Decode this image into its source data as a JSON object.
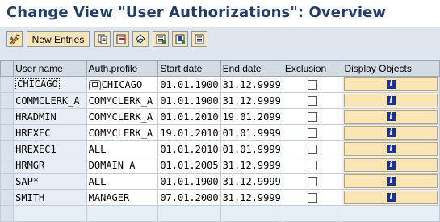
{
  "title": "Change View \"User Authorizations\": Overview",
  "toolbar": {
    "new_entries_label": "New Entries",
    "icons": [
      "edit-display-toggle-icon",
      "copy-icon",
      "delete-icon",
      "undo-icon",
      "select-all-icon",
      "select-block-icon",
      "deselect-all-icon"
    ]
  },
  "table": {
    "columns": [
      "User name",
      "Auth.profile",
      "Start date",
      "End date",
      "Exclusion",
      "Display Objects"
    ],
    "rows": [
      {
        "user": "CHICAGO",
        "profile": "CHICAGO",
        "start": "01.01.1900",
        "end": "31.12.9999",
        "exclusion": false
      },
      {
        "user": "COMMCLERK_A",
        "profile": "COMMCLERK_A",
        "start": "01.01.1900",
        "end": "31.12.9999",
        "exclusion": false
      },
      {
        "user": "HRADMIN",
        "profile": "COMMCLERK_A",
        "start": "01.01.2010",
        "end": "19.01.2099",
        "exclusion": false
      },
      {
        "user": "HREXEC",
        "profile": "COMMCLERK_A",
        "start": "19.01.2010",
        "end": "01.01.9999",
        "exclusion": false
      },
      {
        "user": "HREXEC1",
        "profile": "ALL",
        "start": "01.01.2010",
        "end": "01.01.9999",
        "exclusion": false
      },
      {
        "user": "HRMGR",
        "profile": "DOMAIN A",
        "start": "01.01.2005",
        "end": "31.12.9999",
        "exclusion": false
      },
      {
        "user": "SAP*",
        "profile": "ALL",
        "start": "01.01.1900",
        "end": "31.12.9999",
        "exclusion": false
      },
      {
        "user": "SMITH",
        "profile": "MANAGER",
        "start": "07.01.2000",
        "end": "31.12.9999",
        "exclusion": false
      }
    ]
  },
  "colors": {
    "title_text": "#1f3e6e",
    "button_fill": "#fae6b4",
    "info_icon": "#1330a8",
    "background": "#dfe6ee"
  }
}
